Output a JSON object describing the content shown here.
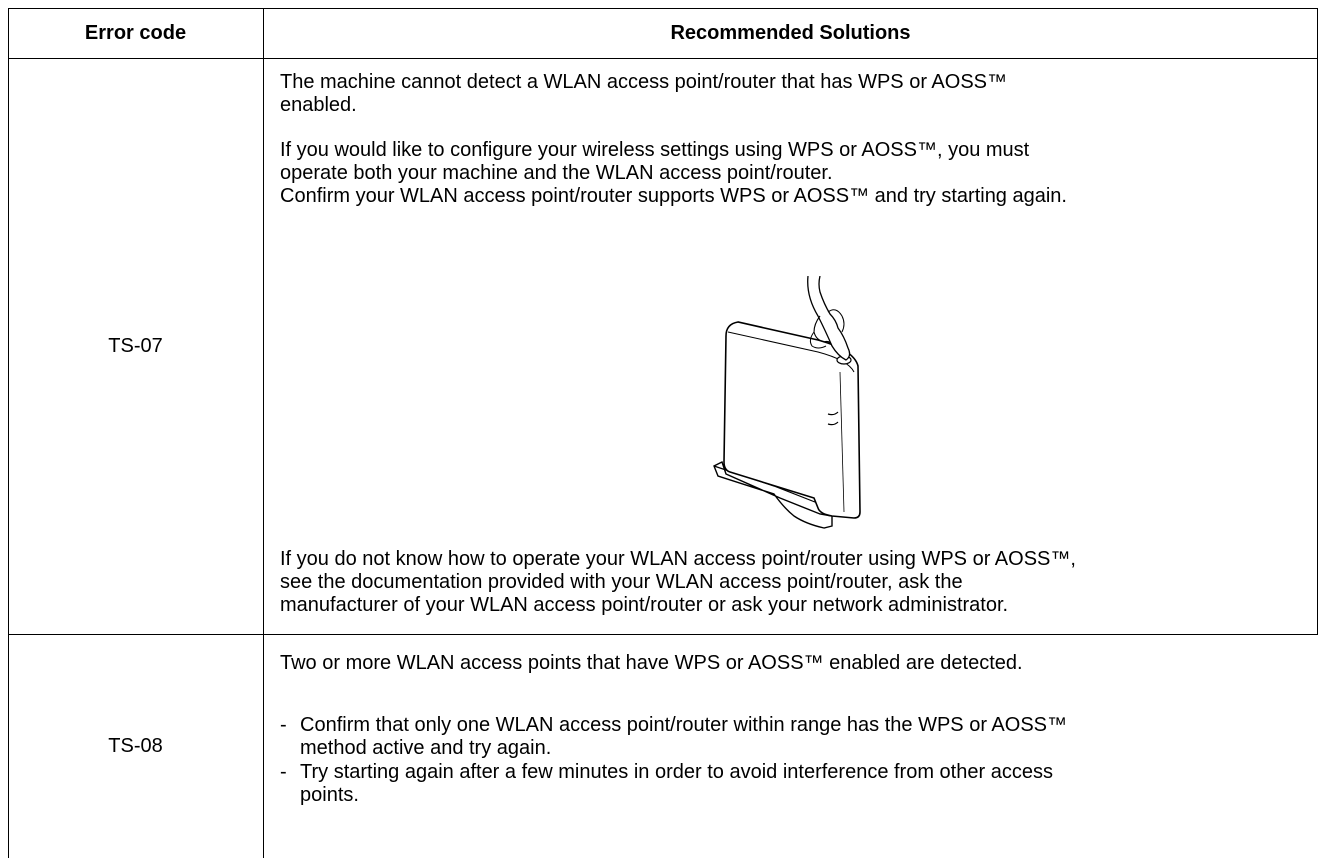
{
  "table": {
    "headers": {
      "code": "Error code",
      "solutions": "Recommended Solutions"
    },
    "rows": [
      {
        "code": "TS-07",
        "p1": "The machine cannot detect a WLAN access point/router that has WPS or AOSS™\nenabled.",
        "p2": "If you would like to configure your wireless settings using WPS or AOSS™, you must\noperate both your machine and the WLAN access point/router.\nConfirm your WLAN access point/router supports WPS or AOSS™ and try starting again.",
        "image": "router-with-finger-pressing-button-icon",
        "p3": "If you do not know how to operate your WLAN access point/router using WPS or AOSS™,\nsee the documentation provided with your WLAN access point/router, ask the\nmanufacturer of your WLAN access point/router or ask your network administrator."
      },
      {
        "code": "TS-08",
        "p1": "Two or more WLAN access points that have WPS or AOSS™ enabled are detected.",
        "bullets": [
          "Confirm that only one WLAN access point/router within range has the WPS or AOSS™\nmethod active and try again.",
          "Try starting again after a few minutes in order to avoid interference from other access\npoints."
        ],
        "bullet_marker": "-"
      }
    ]
  }
}
